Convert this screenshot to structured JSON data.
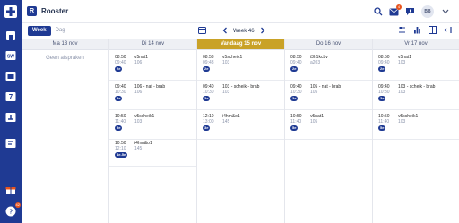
{
  "app": {
    "logo_letter": "R",
    "title": "Rooster"
  },
  "header": {
    "mail_badge": "4",
    "avatar_initials": "BB"
  },
  "toolbar": {
    "week_label": "Week",
    "day_label": "Dag",
    "current_week": "Week 46"
  },
  "sidebar": {
    "help_badge": "42"
  },
  "days": [
    {
      "header": "Ma 13 nov",
      "empty_text": "Geen afspraken",
      "lessons": []
    },
    {
      "header": "Di 14 nov",
      "lessons": [
        {
          "start": "08:50",
          "end": "09:40",
          "hour": "2e",
          "subject": "v5nat1",
          "room": "106"
        },
        {
          "start": "09:40",
          "end": "10:30",
          "hour": "3e",
          "subject": "106 - nat - brab",
          "room": "106"
        },
        {
          "start": "10:50",
          "end": "11:40",
          "hour": "5e",
          "subject": "v5scheik1",
          "room": "103"
        },
        {
          "start": "10:50",
          "end": "12:10",
          "hour": "4e-5e",
          "subject": "i4hm&o1",
          "room": "145"
        }
      ]
    },
    {
      "header": "Vandaag 15 nov",
      "today": true,
      "lessons": [
        {
          "start": "08:53",
          "end": "09:43",
          "hour": "2e",
          "subject": "v5scheik1",
          "room": "103"
        },
        {
          "start": "09:40",
          "end": "10:30",
          "hour": "3e",
          "subject": "103 - scheik - brab",
          "room": "103"
        },
        {
          "start": "12:10",
          "end": "13:00",
          "hour": "3e",
          "subject": "i4hm&o1",
          "room": "145"
        }
      ]
    },
    {
      "header": "Do 16 nov",
      "lessons": [
        {
          "start": "08:50",
          "end": "09:40",
          "hour": "2e",
          "subject": "i3h1kcbv",
          "room": "a203"
        },
        {
          "start": "09:40",
          "end": "10:30",
          "hour": "3e",
          "subject": "105 - nat - brab",
          "room": "105"
        },
        {
          "start": "10:50",
          "end": "11:40",
          "hour": "5e",
          "subject": "v5nat1",
          "room": "105"
        }
      ]
    },
    {
      "header": "Vr 17 nov",
      "lessons": [
        {
          "start": "08:50",
          "end": "09:40",
          "hour": "2e",
          "subject": "v5nat1",
          "room": "103"
        },
        {
          "start": "09:40",
          "end": "10:30",
          "hour": "3e",
          "subject": "103 - scheik - brab",
          "room": "103"
        },
        {
          "start": "10:50",
          "end": "11:40",
          "hour": "5e",
          "subject": "v5scheik1",
          "room": "103"
        }
      ]
    }
  ]
}
